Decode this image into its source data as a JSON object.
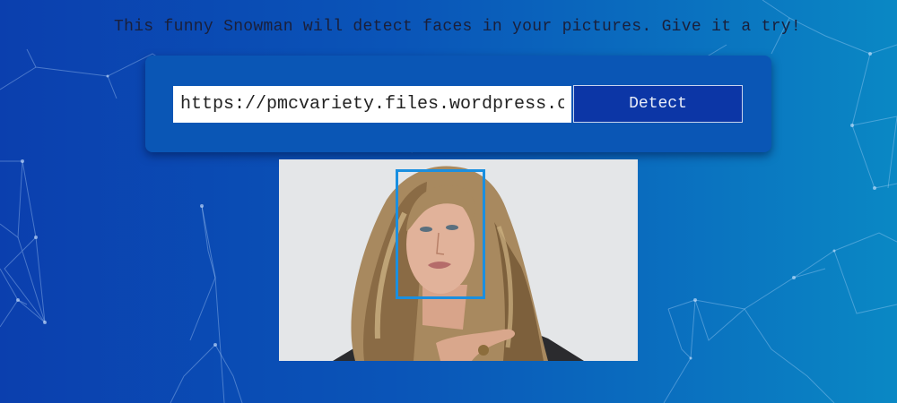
{
  "header": {
    "tagline": "This funny Snowman will detect faces in your pictures. Give it a try!"
  },
  "form": {
    "url_value": "https://pmcvariety.files.wordpress.com",
    "detect_label": "Detect"
  },
  "result": {
    "faces_detected": 1
  },
  "colors": {
    "background_start": "#0b3fae",
    "background_end": "#0a88c4",
    "button": "#0c36a6",
    "face_box": "#1a8fe0"
  }
}
